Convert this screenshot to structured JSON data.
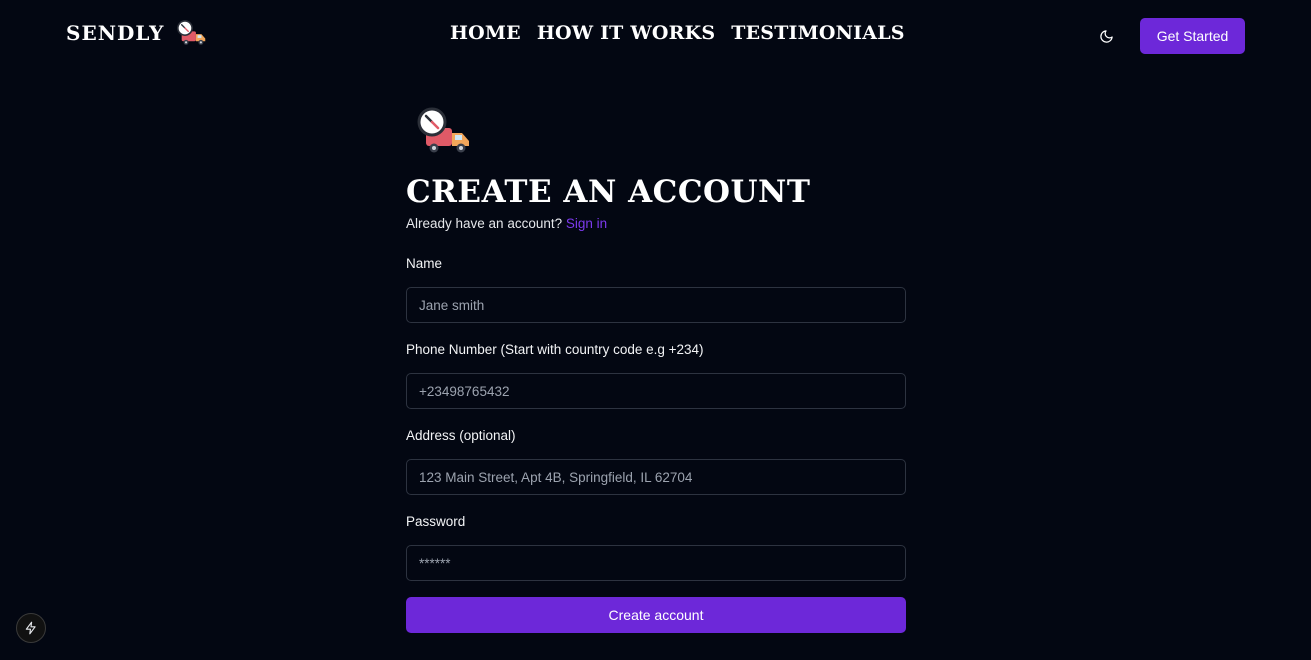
{
  "header": {
    "brand": "SENDLY",
    "nav": [
      {
        "label": "HOME"
      },
      {
        "label": "HOW IT WORKS"
      },
      {
        "label": "TESTIMONIALS"
      }
    ],
    "get_started_label": "Get Started",
    "theme_icon": "moon-icon"
  },
  "form": {
    "title": "CREATE AN ACCOUNT",
    "signin_prompt": "Already have an account?",
    "signin_link": "Sign in",
    "fields": [
      {
        "label": "Name",
        "placeholder": "Jane smith",
        "type": "text"
      },
      {
        "label": "Phone Number (Start with country code e.g +234)",
        "placeholder": "+23498765432",
        "type": "text"
      },
      {
        "label": "Address (optional)",
        "placeholder": "123 Main Street, Apt 4B, Springfield, IL 62704",
        "type": "text"
      },
      {
        "label": "Password",
        "placeholder": "******",
        "type": "password"
      }
    ],
    "submit_label": "Create account"
  },
  "dev_indicator_icon": "lightning-icon",
  "colors": {
    "background": "#030712",
    "accent": "#6d28d9",
    "link": "#7c3aed",
    "input_border": "#2d3340"
  }
}
